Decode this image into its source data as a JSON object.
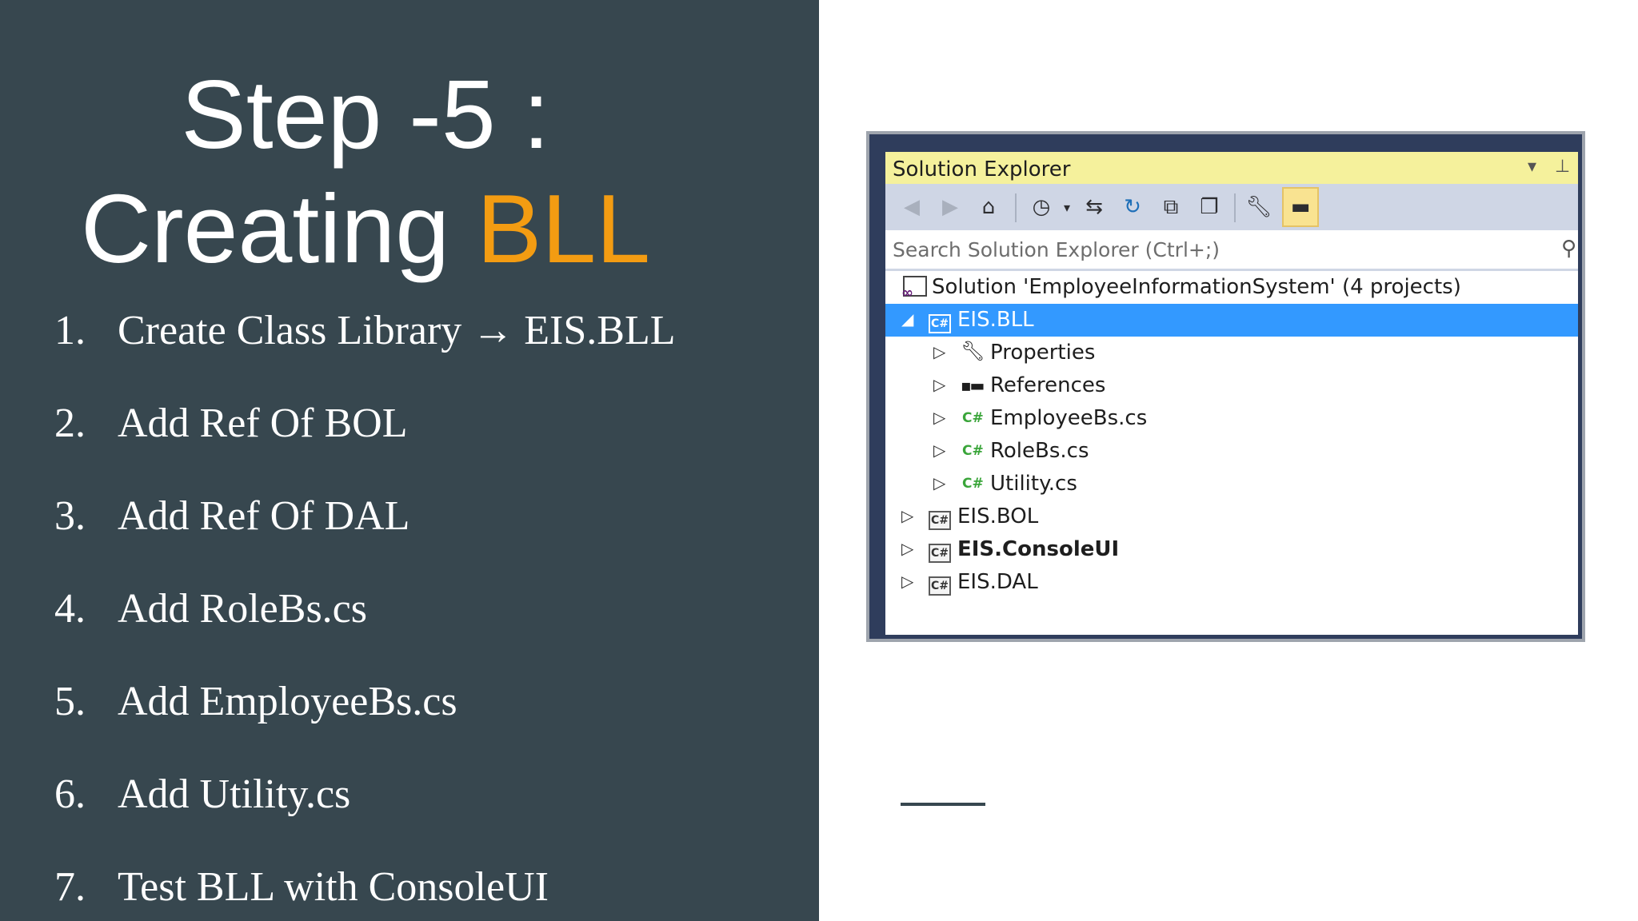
{
  "slide": {
    "title_line1": "Step -5 :",
    "title_line2_prefix": "Creating ",
    "title_line2_accent": "BLL",
    "colors": {
      "background_left": "#37474f",
      "accent": "#f39c12",
      "text": "#ffffff"
    },
    "steps": [
      {
        "num": "1.",
        "text": "Create Class Library → EIS.BLL"
      },
      {
        "num": "2.",
        "text": "Add Ref Of BOL"
      },
      {
        "num": "3.",
        "text": "Add Ref Of DAL"
      },
      {
        "num": "4.",
        "text": "Add RoleBs.cs"
      },
      {
        "num": "5.",
        "text": "Add EmployeeBs.cs"
      },
      {
        "num": "6.",
        "text": "Add Utility.cs"
      },
      {
        "num": "7.",
        "text": "Test BLL with ConsoleUI"
      }
    ]
  },
  "solution_explorer": {
    "title": "Solution Explorer",
    "header_icons": [
      "dropdown-icon",
      "pin-icon"
    ],
    "toolbar_icons": [
      "back-icon",
      "forward-icon",
      "home-icon",
      "pending-changes-icon",
      "sync-icon",
      "refresh-icon",
      "collapse-all-icon",
      "show-all-files-icon",
      "properties-icon",
      "preview-icon"
    ],
    "search_placeholder": "Search Solution Explorer (Ctrl+;)",
    "tree": [
      {
        "label": "Solution 'EmployeeInformationSystem' (4 projects)",
        "icon": "solution-icon",
        "depth": 0
      },
      {
        "label": "EIS.BLL",
        "icon": "csharp-project-icon",
        "depth": 0,
        "expanded": true,
        "selected": true
      },
      {
        "label": "Properties",
        "icon": "wrench-icon",
        "depth": 1
      },
      {
        "label": "References",
        "icon": "references-icon",
        "depth": 1
      },
      {
        "label": "EmployeeBs.cs",
        "icon": "csharp-file-icon",
        "depth": 1
      },
      {
        "label": "RoleBs.cs",
        "icon": "csharp-file-icon",
        "depth": 1
      },
      {
        "label": "Utility.cs",
        "icon": "csharp-file-icon",
        "depth": 1
      },
      {
        "label": "EIS.BOL",
        "icon": "csharp-project-icon",
        "depth": 0
      },
      {
        "label": "EIS.ConsoleUI",
        "icon": "csharp-project-icon",
        "depth": 0,
        "bold": true
      },
      {
        "label": "EIS.DAL",
        "icon": "csharp-project-icon",
        "depth": 0
      }
    ]
  }
}
